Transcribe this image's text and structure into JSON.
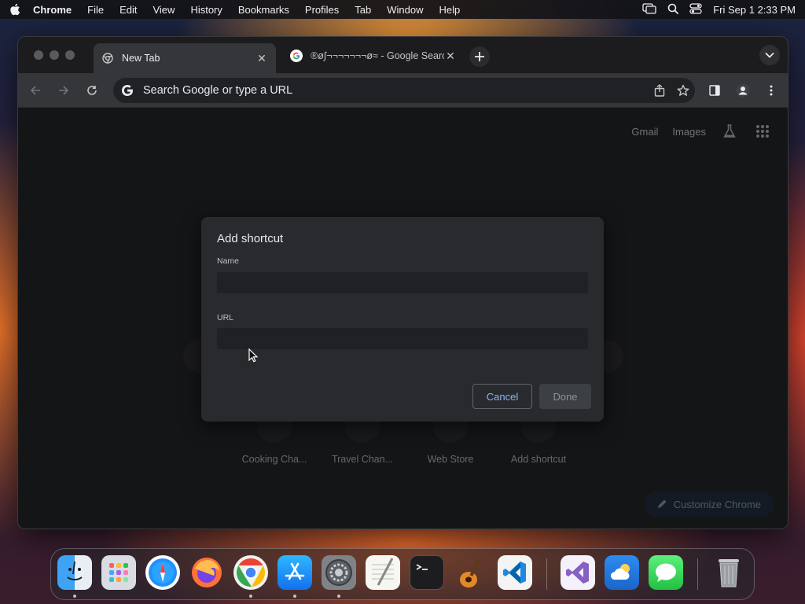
{
  "menubar": {
    "app_name": "Chrome",
    "items": [
      "File",
      "Edit",
      "View",
      "History",
      "Bookmarks",
      "Profiles",
      "Tab",
      "Window",
      "Help"
    ],
    "clock": "Fri Sep 1  2:33 PM"
  },
  "browser": {
    "tabs": [
      {
        "title": "New Tab",
        "favicon": "chrome-icon",
        "active": true
      },
      {
        "title": "®ø∫¬¬¬¬¬¬¬ø≈ - Google Search",
        "favicon": "google-icon",
        "active": false
      }
    ],
    "omnibox": {
      "placeholder": "Search Google or type a URL",
      "value": ""
    },
    "toplinks": {
      "gmail": "Gmail",
      "images": "Images"
    }
  },
  "ntp": {
    "shortcuts": [
      "Cooking Cha...",
      "Travel Chan...",
      "Web Store",
      "Add shortcut"
    ],
    "customize_label": "Customize Chrome"
  },
  "dialog": {
    "title": "Add shortcut",
    "name_label": "Name",
    "name_value": "",
    "url_label": "URL",
    "url_value": "",
    "cancel_label": "Cancel",
    "done_label": "Done"
  },
  "dock": {
    "apps": [
      "finder-icon",
      "launchpad-icon",
      "safari-icon",
      "firefox-icon",
      "chrome-icon",
      "app-store-icon",
      "system-settings-icon",
      "textedit-icon",
      "terminal-icon",
      "garageband-icon",
      "vscode-icon",
      "visual-studio-icon",
      "weather-icon",
      "messages-icon",
      "trash-icon"
    ]
  },
  "colors": {
    "accent": "#8ab4f8",
    "window_bg": "#202124",
    "dialog_bg": "#292a2d"
  }
}
